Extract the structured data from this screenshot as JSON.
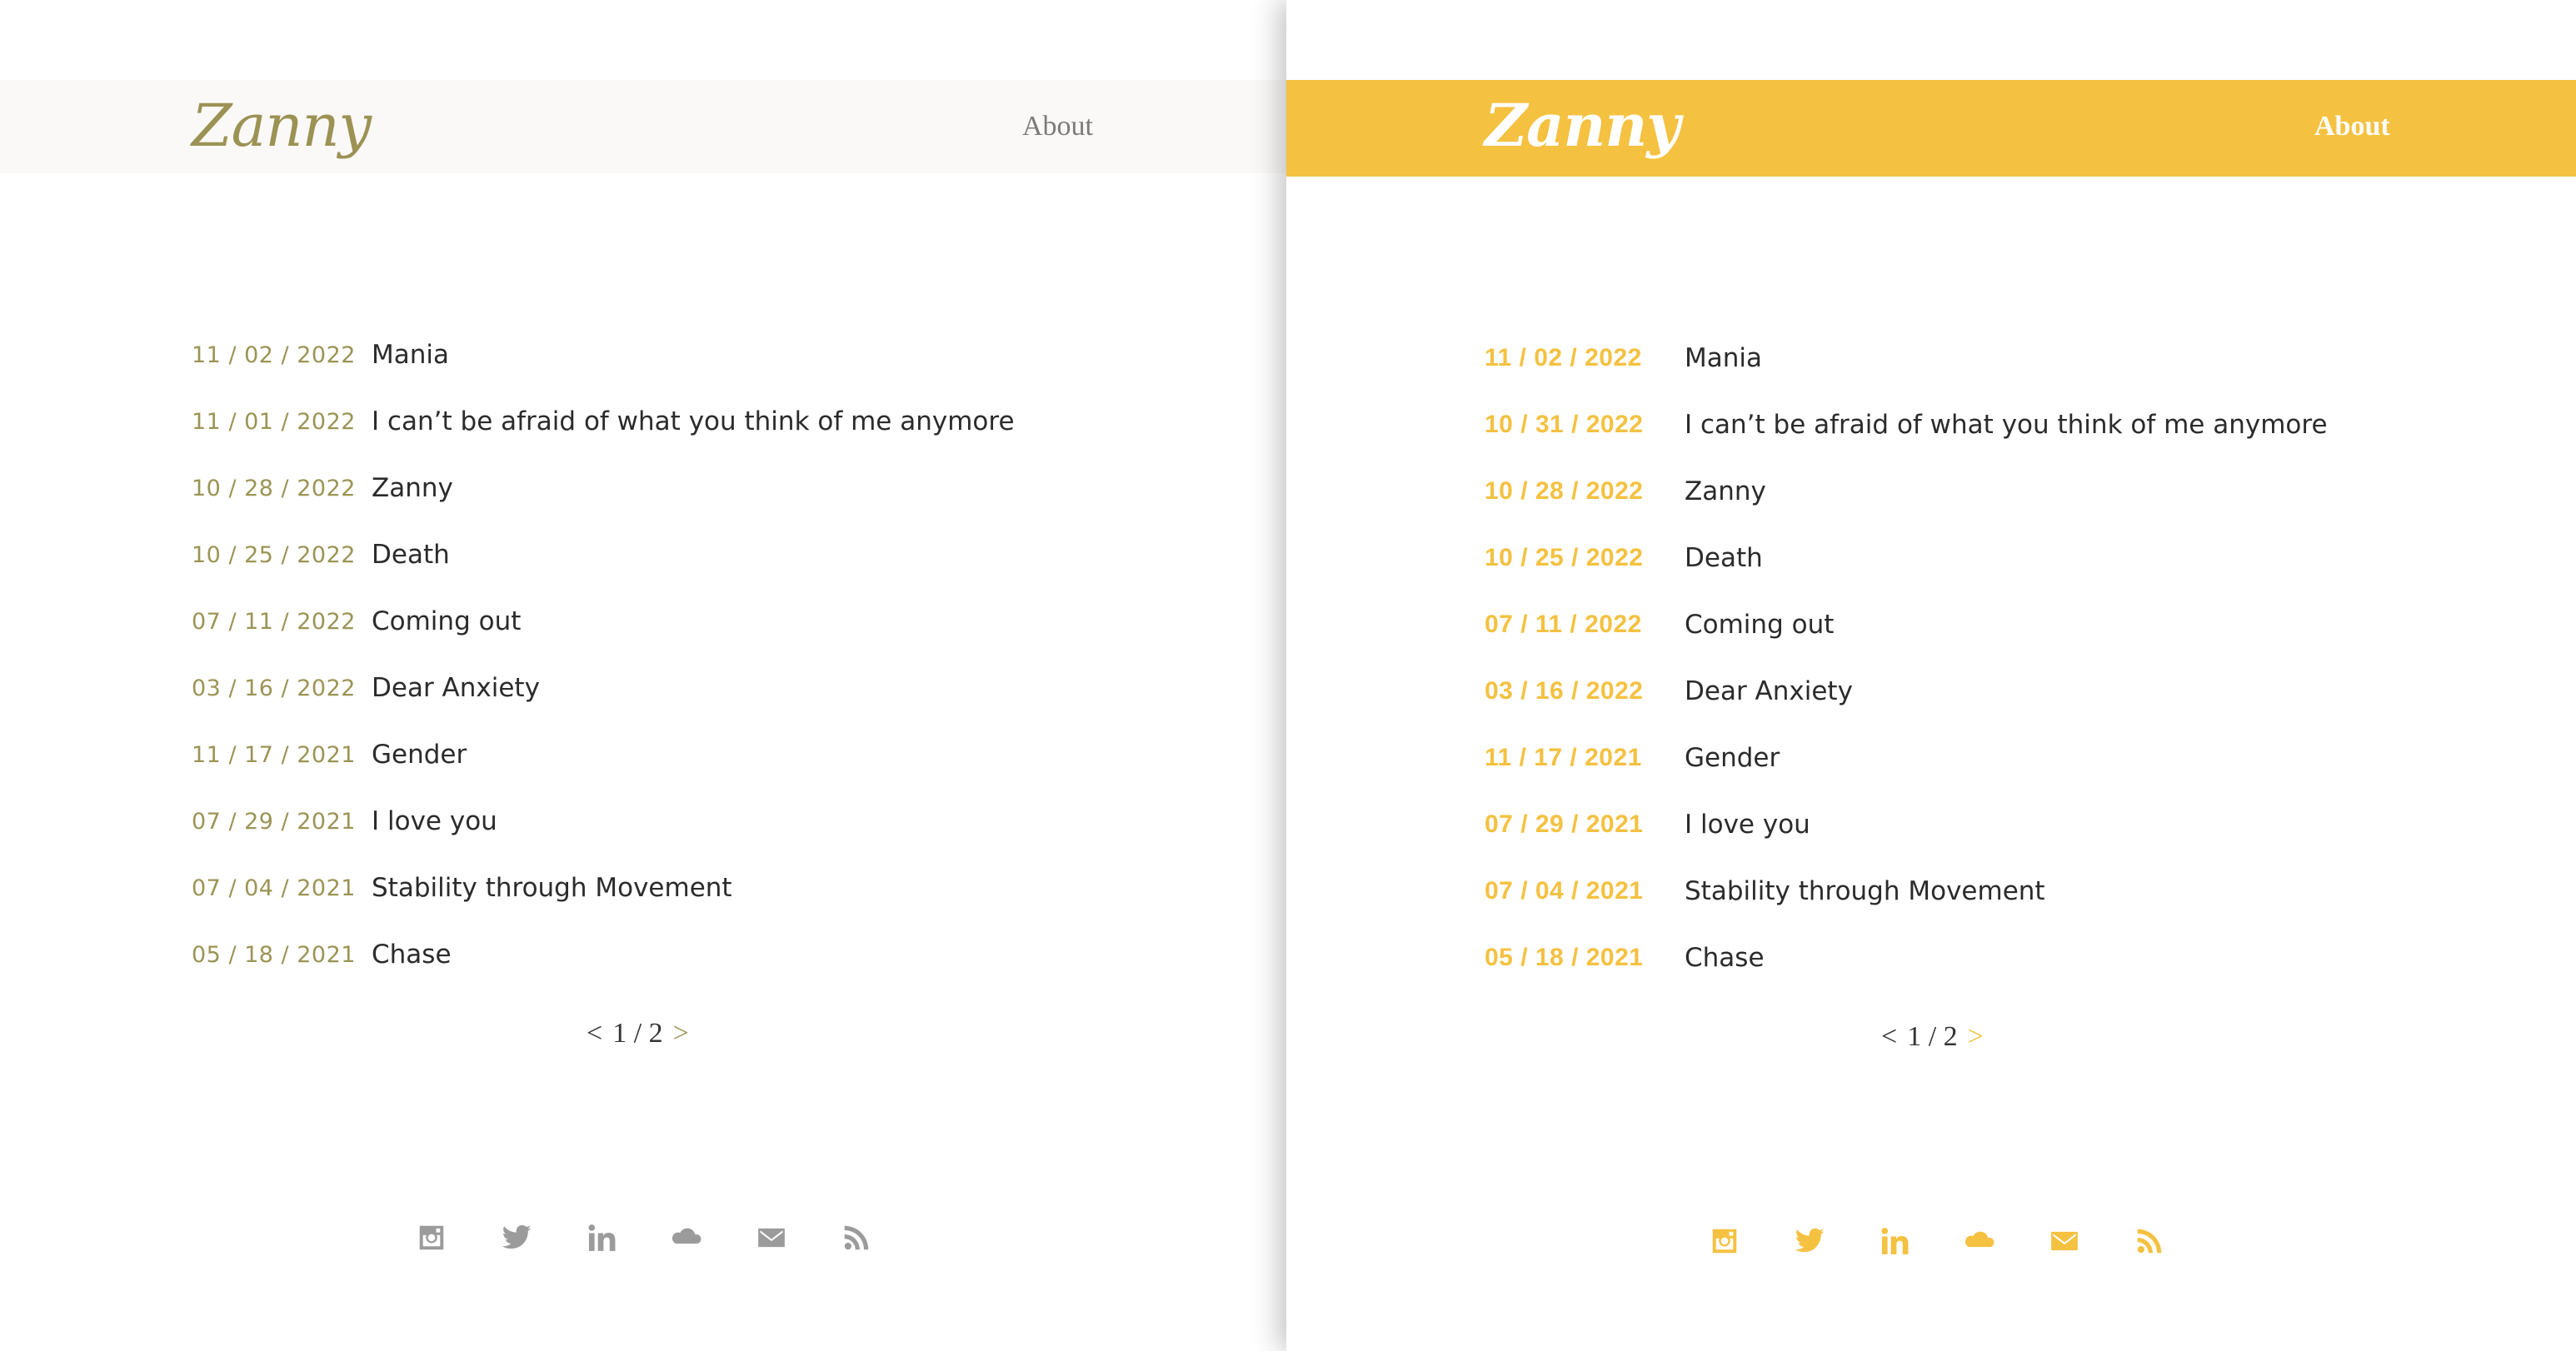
{
  "colors": {
    "left_accent": "#9b9455",
    "right_accent": "#f4c141",
    "text": "#2b2b2b",
    "icon_gray": "#9b9b9b"
  },
  "left": {
    "header": {
      "logo": "Zanny",
      "nav_about": "About"
    },
    "posts": [
      {
        "date": "11 / 02 / 2022",
        "title": "Mania"
      },
      {
        "date": "11 / 01 / 2022",
        "title": "I can’t be afraid of what you think of me anymore"
      },
      {
        "date": "10 / 28 / 2022",
        "title": "Zanny"
      },
      {
        "date": "10 / 25 / 2022",
        "title": "Death"
      },
      {
        "date": "07 / 11 / 2022",
        "title": "Coming out"
      },
      {
        "date": "03 / 16 / 2022",
        "title": "Dear Anxiety"
      },
      {
        "date": "11 / 17 / 2021",
        "title": "Gender"
      },
      {
        "date": "07 / 29 / 2021",
        "title": "I love you"
      },
      {
        "date": "07 / 04 / 2021",
        "title": "Stability through Movement"
      },
      {
        "date": "05 / 18 / 2021",
        "title": "Chase"
      }
    ],
    "pagination": {
      "prev": "<",
      "current": "1 / 2",
      "next": ">"
    },
    "social_icons": [
      "instagram-icon",
      "twitter-icon",
      "linkedin-icon",
      "soundcloud-icon",
      "mail-icon",
      "rss-icon"
    ]
  },
  "right": {
    "header": {
      "logo": "Zanny",
      "nav_about": "About"
    },
    "posts": [
      {
        "date": "11 / 02 / 2022",
        "title": "Mania"
      },
      {
        "date": "10 / 31 / 2022",
        "title": "I can’t be afraid of what you think of me anymore"
      },
      {
        "date": "10 / 28 / 2022",
        "title": "Zanny"
      },
      {
        "date": "10 / 25 / 2022",
        "title": "Death"
      },
      {
        "date": "07 / 11 / 2022",
        "title": "Coming out"
      },
      {
        "date": "03 / 16 / 2022",
        "title": "Dear Anxiety"
      },
      {
        "date": "11 / 17 / 2021",
        "title": "Gender"
      },
      {
        "date": "07 / 29 / 2021",
        "title": "I love you"
      },
      {
        "date": "07 / 04 / 2021",
        "title": "Stability through Movement"
      },
      {
        "date": "05 / 18 / 2021",
        "title": "Chase"
      }
    ],
    "pagination": {
      "prev": "<",
      "current": "1 / 2",
      "next": ">"
    },
    "social_icons": [
      "instagram-icon",
      "twitter-icon",
      "linkedin-icon",
      "soundcloud-icon",
      "mail-icon",
      "rss-icon"
    ]
  }
}
